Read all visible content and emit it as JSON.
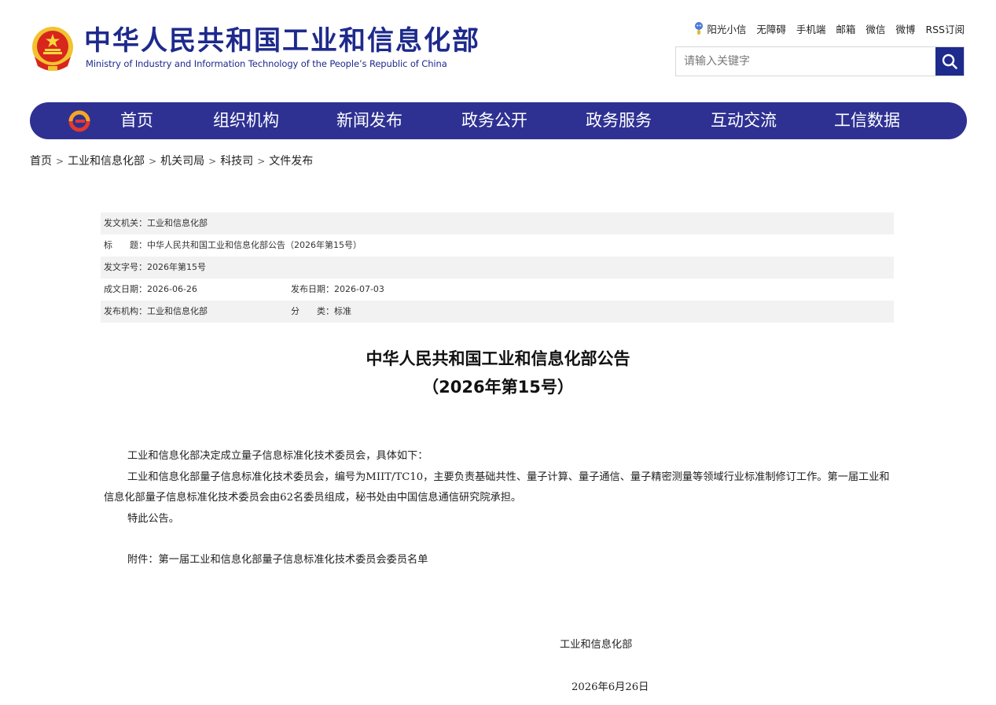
{
  "header": {
    "title_cn": "中华人民共和国工业和信息化部",
    "title_en": "Ministry of Industry and Information Technology of the People’s Republic of China",
    "top_links": [
      "阳光小信",
      "无障碍",
      "手机端",
      "邮箱",
      "微信",
      "微博",
      "RSS订阅"
    ],
    "search_placeholder": "请输入关键字"
  },
  "nav": {
    "items": [
      "首页",
      "组织机构",
      "新闻发布",
      "政务公开",
      "政务服务",
      "互动交流",
      "工信数据"
    ]
  },
  "breadcrumb": [
    "首页",
    "工业和信息化部",
    "机关司局",
    "科技司",
    "文件发布"
  ],
  "meta": {
    "issuer": "发文机关：工业和信息化部",
    "title": "标　　题：中华人民共和国工业和信息化部公告（2026年第15号）",
    "doc_number": "发文字号：2026年第15号",
    "created_date": "成文日期：2026-06-26",
    "published_date": "发布日期：2026-07-03",
    "publisher": "发布机构：工业和信息化部",
    "category": "分　　类：标准"
  },
  "article": {
    "title": "中华人民共和国工业和信息化部公告",
    "number": "（2026年第15号）",
    "paragraphs": [
      "工业和信息化部决定成立量子信息标准化技术委员会，具体如下：",
      "工业和信息化部量子信息标准化技术委员会，编号为MIIT/TC10，主要负责基础共性、量子计算、量子通信、量子精密测量等领域行业标准制修订工作。第一届工业和信息化部量子信息标准化技术委员会由62名委员组成，秘书处由中国信息通信研究院承担。",
      "特此公告。"
    ],
    "attachment": "附件：第一届工业和信息化部量子信息标准化技术委员会委员名单",
    "signature_org": "工业和信息化部",
    "signature_date": "2026年6月26日"
  }
}
